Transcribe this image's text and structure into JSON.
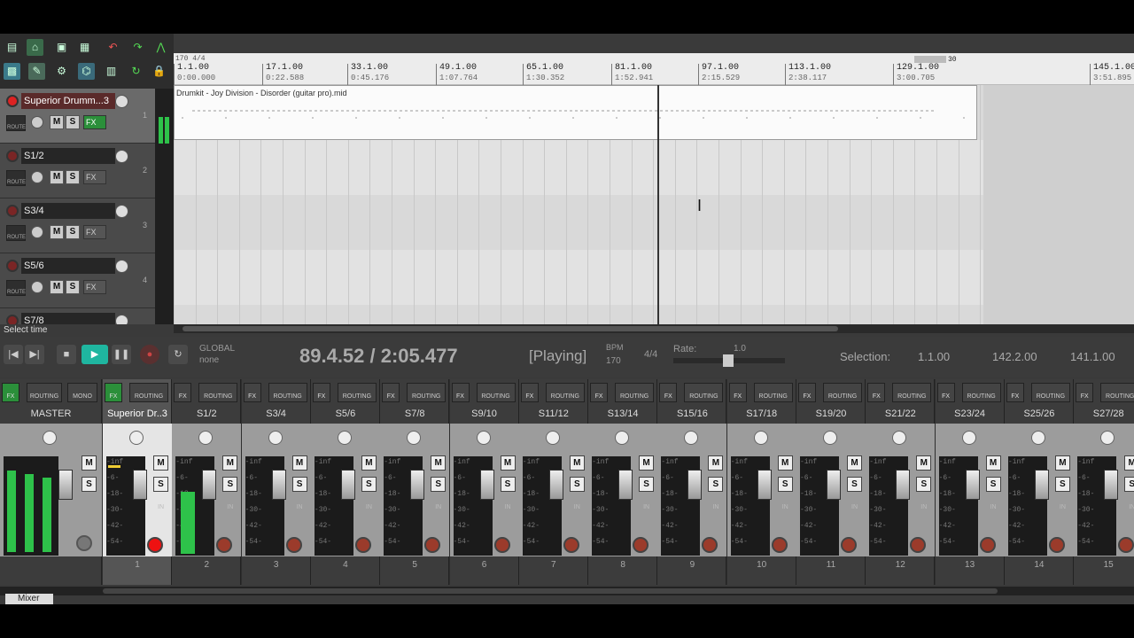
{
  "ruler": {
    "tempo_label": "170 4/4",
    "end_marker": "30",
    "marks": [
      {
        "bar": "1.1.00",
        "time": "0:00.000"
      },
      {
        "bar": "17.1.00",
        "time": "0:22.588"
      },
      {
        "bar": "33.1.00",
        "time": "0:45.176"
      },
      {
        "bar": "49.1.00",
        "time": "1:07.764"
      },
      {
        "bar": "65.1.00",
        "time": "1:30.352"
      },
      {
        "bar": "81.1.00",
        "time": "1:52.941"
      },
      {
        "bar": "97.1.00",
        "time": "2:15.529"
      },
      {
        "bar": "113.1.00",
        "time": "2:38.117"
      },
      {
        "bar": "129.1.00",
        "time": "3:00.705"
      },
      {
        "bar": "145.1.00",
        "time": "3:51.895"
      }
    ]
  },
  "tracks": [
    {
      "name": "Superior Drumm...3",
      "num": "1",
      "selected": true
    },
    {
      "name": "S1/2",
      "num": "2",
      "selected": false
    },
    {
      "name": "S3/4",
      "num": "3",
      "selected": false
    },
    {
      "name": "S5/6",
      "num": "4",
      "selected": false
    },
    {
      "name": "S7/8",
      "num": "",
      "selected": false
    }
  ],
  "track_buttons": {
    "mute": "M",
    "solo": "S",
    "fx": "FX",
    "route": "ROUTE"
  },
  "media_item": {
    "name": "Drumkit - Joy Division - Disorder (guitar pro).mid"
  },
  "status": {
    "text": "Select time"
  },
  "transport": {
    "global_label": "GLOBAL",
    "global_mode": "none",
    "position": "89.4.52 / 2:05.477",
    "state": "[Playing]",
    "bpm_label": "BPM",
    "bpm": "170",
    "timesig": "4/4",
    "rate_label": "Rate:",
    "rate": "1.0",
    "selection_label": "Selection:",
    "sel_start": "1.1.00",
    "sel_end": "142.2.00",
    "sel_len": "141.1.00"
  },
  "mixer": {
    "fx_label": "FX",
    "routing_label": "ROUTING",
    "mono_label": "MONO",
    "in_label": "IN",
    "scale": [
      "-inf",
      "-6-",
      "-18-",
      "-30-",
      "-42-",
      "-54-"
    ],
    "master": {
      "name": "MASTER"
    },
    "strips": [
      {
        "name": "Superior Dr..3",
        "num": "1",
        "selected": true,
        "rec": true
      },
      {
        "name": "S1/2",
        "num": "2",
        "selected": false,
        "rec": false
      },
      {
        "name": "S3/4",
        "num": "3",
        "selected": false,
        "rec": false
      },
      {
        "name": "S5/6",
        "num": "4",
        "selected": false,
        "rec": false
      },
      {
        "name": "S7/8",
        "num": "5",
        "selected": false,
        "rec": false
      },
      {
        "name": "S9/10",
        "num": "6",
        "selected": false,
        "rec": false
      },
      {
        "name": "S11/12",
        "num": "7",
        "selected": false,
        "rec": false
      },
      {
        "name": "S13/14",
        "num": "8",
        "selected": false,
        "rec": false
      },
      {
        "name": "S15/16",
        "num": "9",
        "selected": false,
        "rec": false
      },
      {
        "name": "S17/18",
        "num": "10",
        "selected": false,
        "rec": false
      },
      {
        "name": "S19/20",
        "num": "11",
        "selected": false,
        "rec": false
      },
      {
        "name": "S21/22",
        "num": "12",
        "selected": false,
        "rec": false
      },
      {
        "name": "S23/24",
        "num": "13",
        "selected": false,
        "rec": false
      },
      {
        "name": "S25/26",
        "num": "14",
        "selected": false,
        "rec": false
      },
      {
        "name": "S27/28",
        "num": "15",
        "selected": false,
        "rec": false
      }
    ],
    "tab_label": "Mixer"
  },
  "colors": {
    "accent_green": "#2b8f3a",
    "record_red": "#e11111",
    "meter_green": "#2ec24a"
  }
}
